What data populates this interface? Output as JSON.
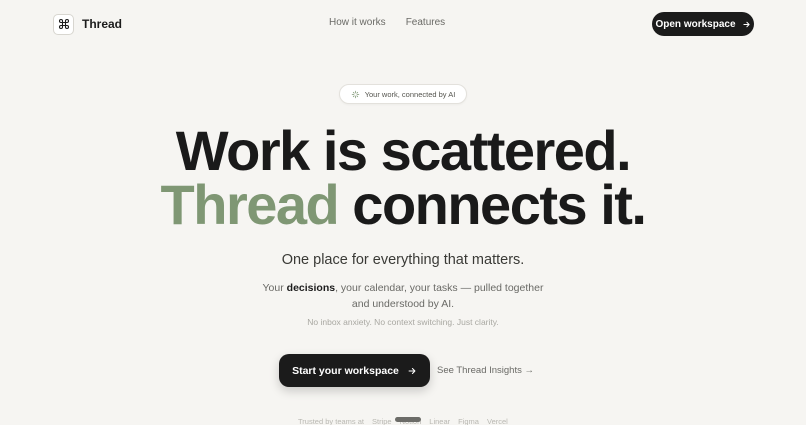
{
  "brand": {
    "name": "Thread",
    "logo_icon": "command-icon"
  },
  "nav": {
    "links": [
      "How it works",
      "Features"
    ],
    "cta_label": "Open workspace",
    "cta_icon": "arrow-right-icon"
  },
  "badge": {
    "icon": "sparkle-icon",
    "text": "Your work, connected by AI"
  },
  "hero": {
    "line1": "Work is scattered.",
    "line2_accent": "Thread",
    "line2_rest": " connects it.",
    "accent_color": "#7f9774"
  },
  "subtitle": "One place for everything that matters.",
  "description": {
    "prefix": "Your ",
    "bold": "decisions",
    "suffix": ", your calendar, your tasks — pulled together",
    "line2": "and understood by AI."
  },
  "note": "No inbox anxiety. No context switching. Just clarity.",
  "cta": {
    "primary_label": "Start your workspace",
    "secondary_label": "See Thread Insights →"
  },
  "trusted": {
    "label": "Trusted by teams at",
    "companies": [
      "Stripe",
      "Notion",
      "Linear",
      "Figma",
      "Vercel"
    ]
  }
}
